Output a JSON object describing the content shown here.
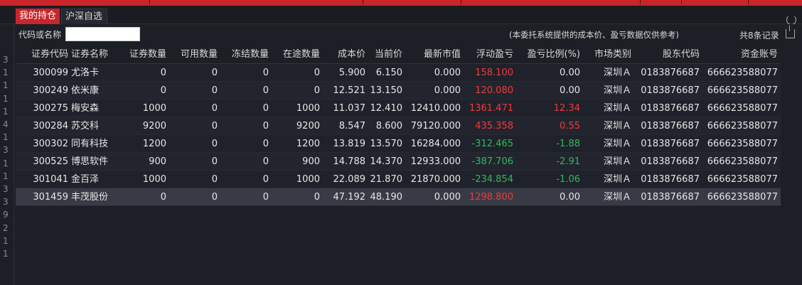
{
  "tabs": {
    "holdings": "我的持仓",
    "watchlist": "沪深自选"
  },
  "filter": {
    "label": "代码或名称",
    "input_value": "",
    "note": "(本委托系统提供的成本价、盈亏数据仅供参考)",
    "record_count": "共8条记录"
  },
  "gutter_digits": [
    "3",
    "1",
    "1",
    "1",
    "1",
    "4",
    "1",
    "3",
    "1",
    "1",
    "3",
    "3",
    "9",
    "2",
    "1",
    "1"
  ],
  "columns": [
    "证券代码",
    "证券名称",
    "证券数量",
    "可用数量",
    "冻结数量",
    "在途数量",
    "成本价",
    "当前价",
    "最新市值",
    "浮动盈亏",
    "盈亏比例(%)",
    "市场类别",
    "股东代码",
    "资金账号"
  ],
  "rows": [
    [
      "300099",
      "尤洛卡",
      "0",
      "0",
      "0",
      "0",
      "5.900",
      "6.150",
      "0.000",
      "158.100",
      "0.00",
      "深圳Ａ",
      "0183876687",
      "666623588077"
    ],
    [
      "300249",
      "依米康",
      "0",
      "0",
      "0",
      "0",
      "12.521",
      "13.150",
      "0.000",
      "120.080",
      "0.00",
      "深圳Ａ",
      "0183876687",
      "666623588077"
    ],
    [
      "300275",
      "梅安森",
      "1000",
      "0",
      "0",
      "1000",
      "11.037",
      "12.410",
      "12410.000",
      "1361.471",
      "12.34",
      "深圳Ａ",
      "0183876687",
      "666623588077"
    ],
    [
      "300284",
      "苏交科",
      "9200",
      "0",
      "0",
      "9200",
      "8.547",
      "8.600",
      "79120.000",
      "435.358",
      "0.55",
      "深圳Ａ",
      "0183876687",
      "666623588077"
    ],
    [
      "300302",
      "同有科技",
      "1200",
      "0",
      "0",
      "1200",
      "13.819",
      "13.570",
      "16284.000",
      "-312.465",
      "-1.88",
      "深圳Ａ",
      "0183876687",
      "666623588077"
    ],
    [
      "300525",
      "博思软件",
      "900",
      "0",
      "0",
      "900",
      "14.788",
      "14.370",
      "12933.000",
      "-387.706",
      "-2.91",
      "深圳Ａ",
      "0183876687",
      "666623588077"
    ],
    [
      "301041",
      "金百泽",
      "1000",
      "0",
      "0",
      "1000",
      "22.089",
      "21.870",
      "21870.000",
      "-234.854",
      "-1.06",
      "深圳Ａ",
      "0183876687",
      "666623588077"
    ],
    [
      "301459",
      "丰茂股份",
      "0",
      "0",
      "0",
      "0",
      "47.192",
      "48.190",
      "0.000",
      "1298.800",
      "0.00",
      "深圳Ａ",
      "0183876687",
      "666623588077"
    ]
  ],
  "selected_row": 7,
  "colors": {
    "accent": "#c8262b",
    "profit": "#ef3a3f",
    "loss": "#2dbb5f",
    "background": "#1c1f26"
  },
  "icons": {
    "refresh": "refresh-icon",
    "export": "export-icon"
  }
}
